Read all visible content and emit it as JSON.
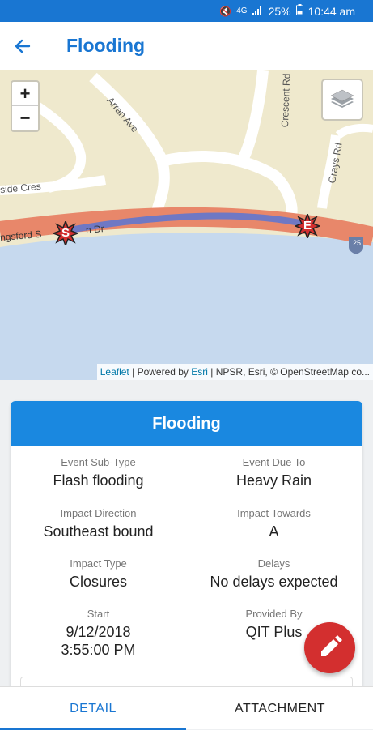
{
  "status_bar": {
    "battery": "25%",
    "time": "10:44 am",
    "network": "4G"
  },
  "app_bar": {
    "title": "Flooding"
  },
  "map": {
    "streets": [
      "Arran Ave",
      "Crescent Rd",
      "Grays Rd",
      "side Cres",
      "ngsford S",
      "n Dr"
    ],
    "route_shield": "25",
    "markers": {
      "start": "S",
      "end": "E"
    },
    "zoom_in": "+",
    "zoom_out": "−",
    "attribution": {
      "leaflet": "Leaflet",
      "powered_by": "Powered by",
      "esri": "Esri",
      "rest": "| NPSR, Esri, © OpenStreetMap co..."
    }
  },
  "card": {
    "title": "Flooding",
    "fields": [
      {
        "label": "Event Sub-Type",
        "value": "Flash flooding"
      },
      {
        "label": "Event Due To",
        "value": "Heavy Rain"
      },
      {
        "label": "Impact Direction",
        "value": "Southeast bound"
      },
      {
        "label": "Impact Towards",
        "value": "A"
      },
      {
        "label": "Impact Type",
        "value": "Closures"
      },
      {
        "label": "Delays",
        "value": "No delays expected"
      },
      {
        "label": "Start",
        "value": "9/12/2018",
        "value2": "3:55:00 PM"
      },
      {
        "label": "Provided By",
        "value": "QIT Plus"
      }
    ]
  },
  "tabs": {
    "detail": "DETAIL",
    "attachment": "ATTACHMENT"
  },
  "colors": {
    "primary": "#1976d2",
    "fab": "#d32f2f",
    "water": "#c6d9ee",
    "land": "#efe9cd",
    "road_route": "#e8876a",
    "route_line": "#6f78c4"
  }
}
